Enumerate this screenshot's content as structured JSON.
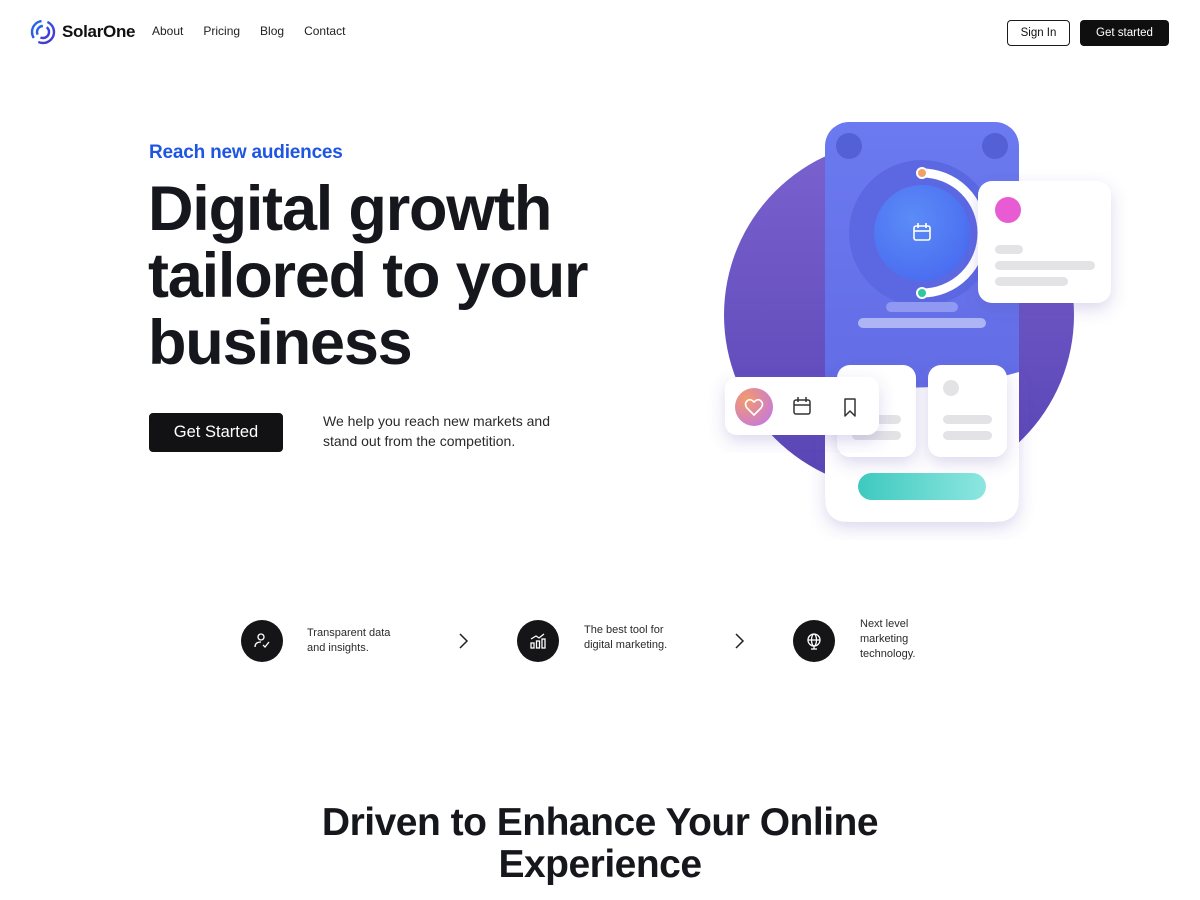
{
  "brand": {
    "name": "SolarOne",
    "accent": "#1e55e3"
  },
  "nav": {
    "items": [
      "About",
      "Pricing",
      "Blog",
      "Contact"
    ]
  },
  "header": {
    "sign_in_label": "Sign In",
    "get_started_label": "Get started"
  },
  "hero": {
    "eyebrow": "Reach new audiences",
    "title_line1": "Digital growth",
    "title_line2": "tailored to your",
    "title_line3": "business",
    "cta_label": "Get Started",
    "description": "We help you reach new markets and stand out from the competition."
  },
  "features": [
    {
      "icon": "user-check-icon",
      "text_line1": "Transparent data",
      "text_line2": "and insights.",
      "text_line3": ""
    },
    {
      "icon": "bar-chart-icon",
      "text_line1": "The best tool for",
      "text_line2": "digital marketing.",
      "text_line3": ""
    },
    {
      "icon": "globe-icon",
      "text_line1": "Next level",
      "text_line2": "marketing",
      "text_line3": "technology."
    }
  ],
  "section": {
    "title_line1": "Driven to Enhance Your Online",
    "title_line2": "Experience"
  },
  "colors": {
    "phone": "#6a77ec",
    "circle": "#6a55c4",
    "teal": "#3ec9bf",
    "pink": "#e85bd3"
  }
}
